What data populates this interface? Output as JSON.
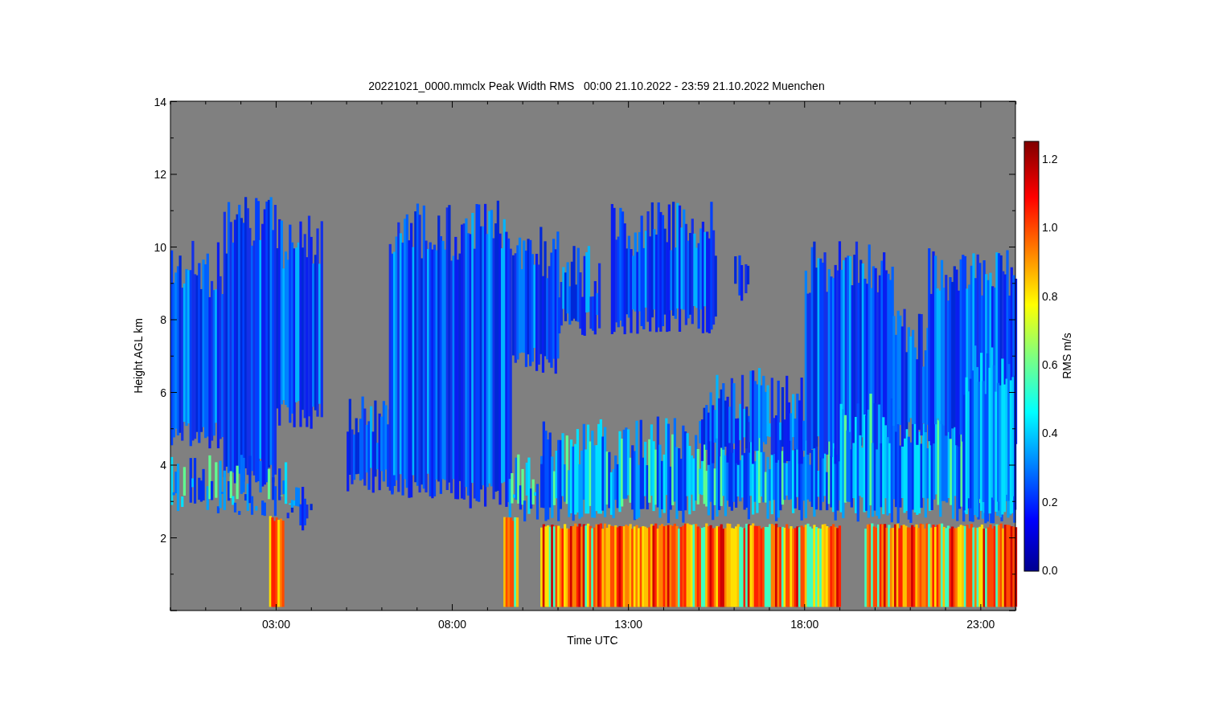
{
  "title": "20221021_0000.mmclx Peak Width RMS   00:00 21.10.2022 - 23:59 21.10.2022 Muenchen",
  "y_axis": {
    "label": "Height AGL km",
    "ticks": [
      "14",
      "12",
      "10",
      "8",
      "6",
      "4",
      "2"
    ]
  },
  "x_axis": {
    "label": "Time UTC",
    "ticks": [
      "03:00",
      "08:00",
      "13:00",
      "18:00",
      "23:00"
    ]
  },
  "colorbar": {
    "label": "RMS m/s",
    "ticks": [
      "1.2",
      "1.0",
      "0.8",
      "0.6",
      "0.4",
      "0.2",
      "0.0"
    ]
  }
}
